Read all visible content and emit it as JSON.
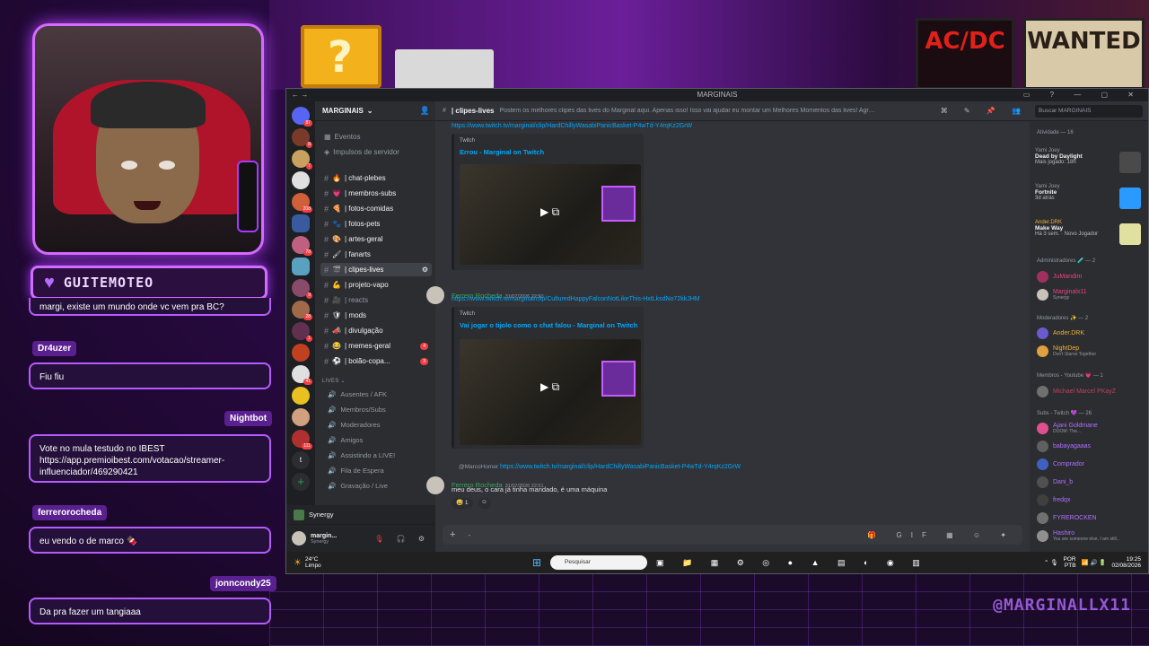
{
  "stream": {
    "streamer_name": "GUITEMOTEO",
    "watermark": "@MARGINALLX11",
    "background_posters": [
      "AC/DC",
      "WANTED"
    ],
    "block_glyph": "?"
  },
  "stream_chat": [
    {
      "user": "",
      "text": "margi, existe um mundo onde vc vem pra BC?"
    },
    {
      "user": "Dr4uzer",
      "text": "Fiu fiu"
    },
    {
      "user": "Nightbot",
      "text": "Vote no mula testudo no IBEST https://app.premioibest.com/votacao/streamer-influenciador/469290421"
    },
    {
      "user": "ferrerorocheda",
      "text": "eu vendo o de marco 🍫"
    },
    {
      "user": "jonncondy25",
      "text": "Da pra fazer um tangiaaa"
    }
  ],
  "discord": {
    "window_title": "MARGINAIS",
    "server_name": "MARGINAIS",
    "server_menu": [
      "Eventos",
      "Impulsos de servidor"
    ],
    "channels": [
      {
        "name": "| chat-plebes",
        "emoji": "🔥"
      },
      {
        "name": "| membros-subs",
        "emoji": "💗"
      },
      {
        "name": "| fotos-comidas",
        "emoji": "🍕"
      },
      {
        "name": "| fotos-pets",
        "emoji": "🐾"
      },
      {
        "name": "| artes-geral",
        "emoji": "🎨"
      },
      {
        "name": "| fanarts",
        "emoji": "🖌"
      },
      {
        "name": "| clipes-lives",
        "emoji": "🎬",
        "active": true
      },
      {
        "name": "| projeto-vapo",
        "emoji": "💪"
      },
      {
        "name": "| reacts",
        "emoji": "🎥"
      },
      {
        "name": "| mods",
        "emoji": "🛡"
      },
      {
        "name": "| divulgação",
        "emoji": "📣"
      },
      {
        "name": "| memes-geral",
        "emoji": "😂",
        "mentions": "4"
      },
      {
        "name": "| bolão-copa...",
        "emoji": "⚽",
        "mentions": "3"
      }
    ],
    "voice_category": "LIVES",
    "voice_channels": [
      "Ausentes / AFK",
      "Membros/Subs",
      "Moderadores",
      "Amigos",
      "Assistindo a LIVE!",
      "Fila de Espera",
      "Gravação / Live"
    ],
    "activity_panel": "Synergy",
    "user": {
      "name": "margin...",
      "status": "Synergy"
    },
    "current_channel": "| clipes-lives",
    "channel_topic": "Postem os melhores clipes das lives do Marginal aqui. Apenas isso! Isso vai ajudar eu montar um Melhores Momentos das lives! Agradeço!",
    "search_placeholder": "Buscar MARGINAIS",
    "messages": [
      {
        "link": "https://www.twitch.tv/marginal/clip/HardChillyWasabiPanicBasket-P4wTd-Y4rqKz2GrW",
        "embed_provider": "Twitch",
        "embed_title": "Errou - Marginal on Twitch"
      },
      {
        "author": "Ferrero Rocheda",
        "time": "31/07/2026 22:50",
        "link": "https://www.twitch.tv/marginal/clip/CulturedHappyFalconNotLikeThis-HxtLksdNo72kkJHM",
        "embed_provider": "Twitch",
        "embed_title": "Vai jogar o tijolo como o chat falou - Marginal on Twitch"
      },
      {
        "reply_to": "@MarcoHomer",
        "reply_link": "https://www.twitch.tv/marginal/clip/HardChillyWasabiPanicBasket-P4wTd-Y4rqKz2GrW",
        "author": "Ferrero Rocheda",
        "time": "31/07/2026 22:51",
        "text": "meu deus, o cara já tinha mandado, é uma máquina",
        "reaction": "1"
      }
    ],
    "members": {
      "activity_header": "Atividade — 16",
      "activities": [
        {
          "user": "Yami Joey",
          "game": "Dead by Daylight",
          "detail": "Mais jogado: 18h"
        },
        {
          "user": "Yami Joey",
          "game": "Fortnite",
          "detail": "3d atrás"
        },
        {
          "user": "Ander.DRK",
          "game": "Make Way",
          "detail": "Há 3 sem. · Novo Jogador"
        }
      ],
      "sections": [
        {
          "title": "Administradores 🧪 — 2",
          "members": [
            {
              "name": "JuMandim",
              "status": ""
            },
            {
              "name": "Marginalx11",
              "status": "Synergy"
            }
          ]
        },
        {
          "title": "Moderadores ✨ — 2",
          "members": [
            {
              "name": "Ander.DRK",
              "status": ""
            },
            {
              "name": "NightDep",
              "status": "Don't Starve Together"
            }
          ]
        },
        {
          "title": "Membros - Youtube 💗 — 1",
          "members": [
            {
              "name": "Michael Marcel PKayZ",
              "status": ""
            }
          ]
        },
        {
          "title": "Subs - Twitch 💜 — 26",
          "members": [
            {
              "name": "Ajani Goldmane",
              "status": "DOOM: The..."
            },
            {
              "name": "babayagaaas",
              "status": ""
            },
            {
              "name": "Comprador",
              "status": ""
            },
            {
              "name": "Dani_b",
              "status": ""
            },
            {
              "name": "fredqx",
              "status": ""
            },
            {
              "name": "FYREROCKEN",
              "status": ""
            },
            {
              "name": "Hashiro",
              "status": "You are someone else, I am still..."
            }
          ]
        }
      ]
    }
  },
  "taskbar": {
    "temperature": "24°C",
    "weather": "Limpo",
    "search_placeholder": "Pesquisar",
    "language": "POR",
    "layout": "PTB",
    "time": "19:25",
    "date": "02/08/2026"
  },
  "colors": {
    "accent_purple": "#b65cff",
    "discord_bg": "#313338",
    "link_blue": "#00a8fc",
    "mention_red": "#f23f43"
  }
}
